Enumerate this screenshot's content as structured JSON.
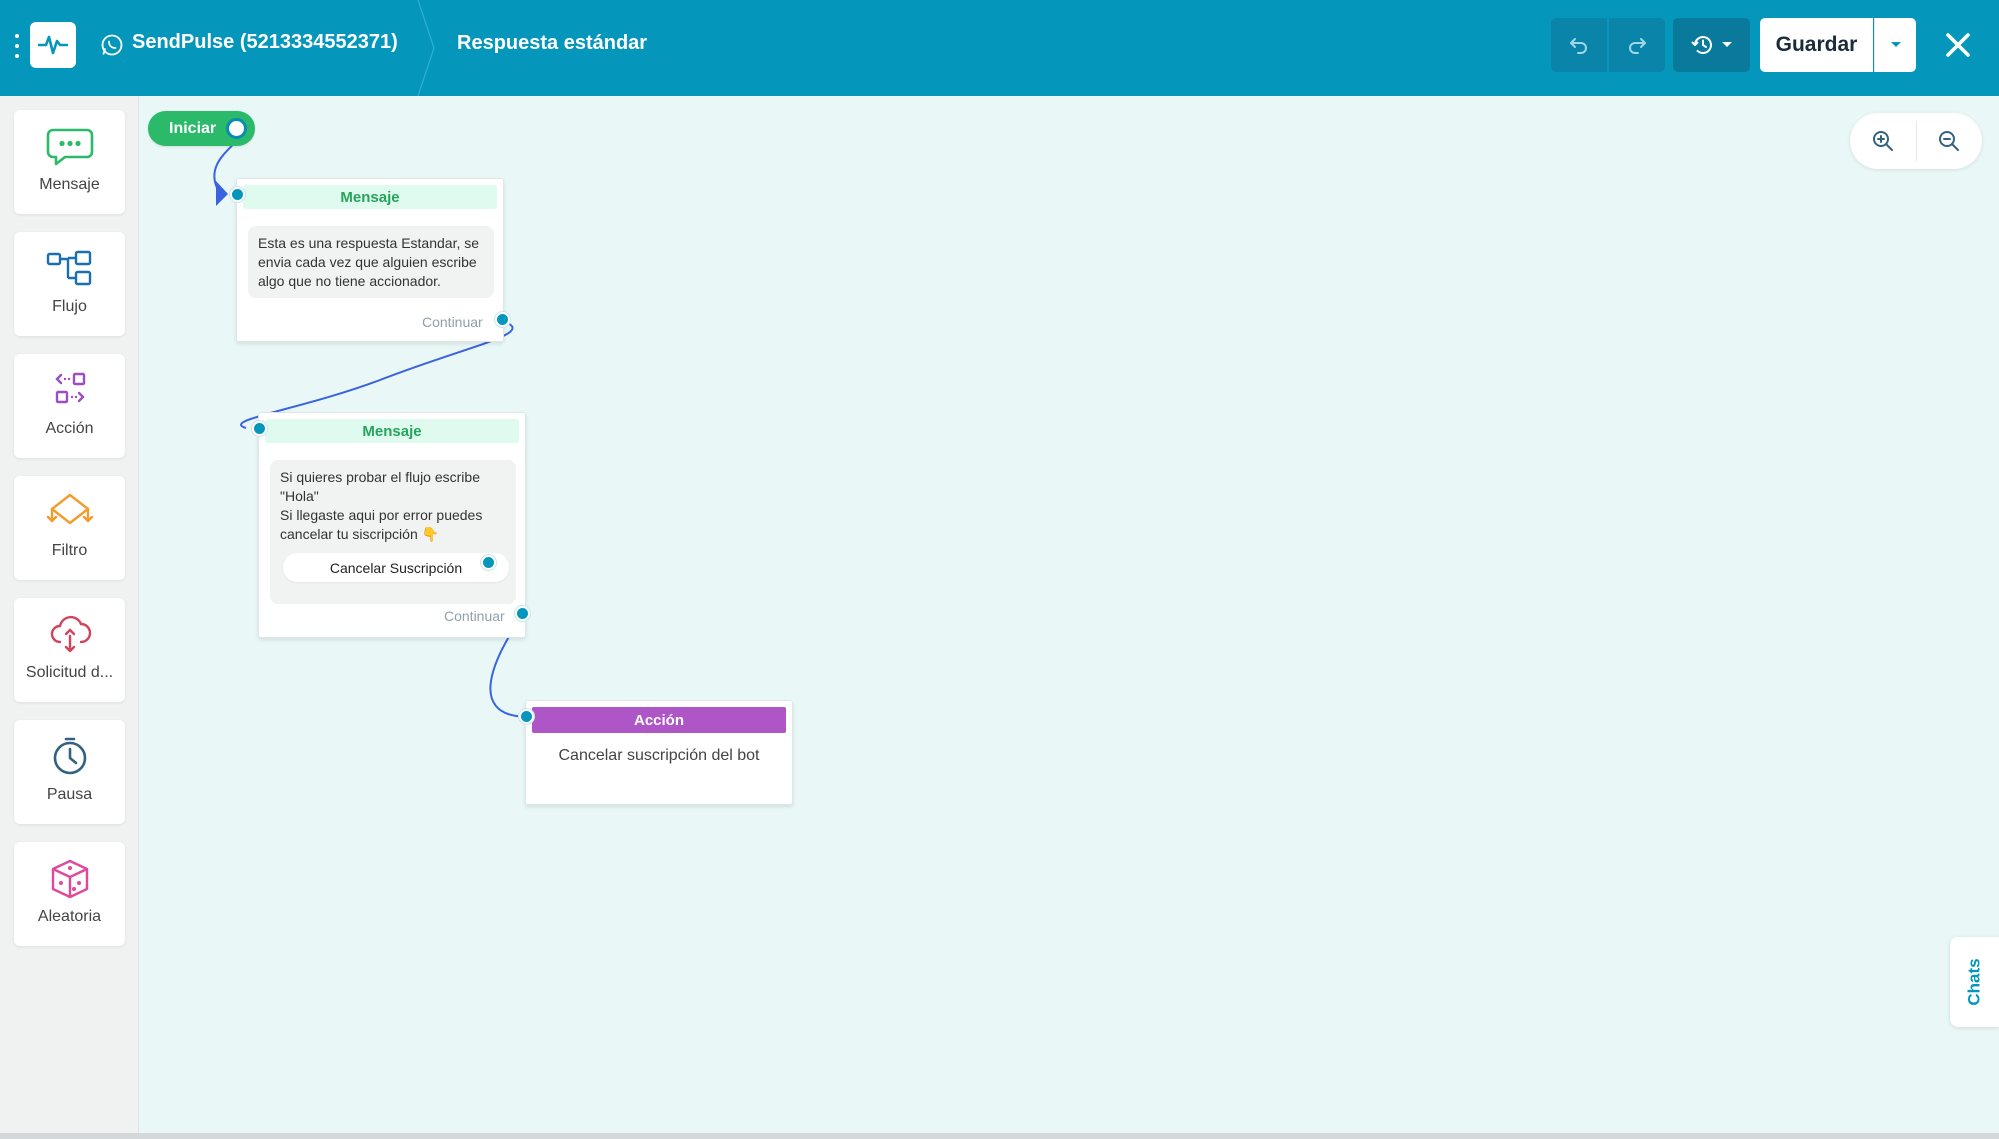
{
  "header": {
    "bot_name": "SendPulse (5213334552371)",
    "flow_name": "Respuesta estándar",
    "save_label": "Guardar"
  },
  "sidebar": {
    "tools": [
      {
        "label": "Mensaje",
        "icon": "message-bubble-icon",
        "color": "#2bba6a"
      },
      {
        "label": "Flujo",
        "icon": "flow-icon",
        "color": "#1a6fb0"
      },
      {
        "label": "Acción",
        "icon": "action-icon",
        "color": "#9b4fc0"
      },
      {
        "label": "Filtro",
        "icon": "filter-icon",
        "color": "#f39b2b"
      },
      {
        "label": "Solicitud d...",
        "icon": "api-request-icon",
        "color": "#d2445d"
      },
      {
        "label": "Pausa",
        "icon": "clock-icon",
        "color": "#34627e"
      },
      {
        "label": "Aleatoria",
        "icon": "dice-icon",
        "color": "#e0489b"
      }
    ]
  },
  "canvas": {
    "start_label": "Iniciar",
    "nodes": [
      {
        "type": "message",
        "title": "Mensaje",
        "text": "Esta es una respuesta Estandar, se envia cada vez que alguien escribe algo que no tiene accionador.",
        "continue_label": "Continuar"
      },
      {
        "type": "message",
        "title": "Mensaje",
        "text_lines": [
          "Si quieres probar el flujo escribe",
          "\"Hola\"",
          "Si llegaste aqui por error puedes",
          "cancelar tu siscripción 👇"
        ],
        "button_label": "Cancelar Suscripción",
        "continue_label": "Continuar"
      },
      {
        "type": "action",
        "title": "Acción",
        "text": "Cancelar suscripción del bot"
      }
    ]
  },
  "chats_tab": "Chats",
  "colors": {
    "header": "#0596bc",
    "message_header": "#dffaee",
    "action_header": "#ae56c5",
    "start": "#2bba6a",
    "wire": "#3a63e0"
  }
}
